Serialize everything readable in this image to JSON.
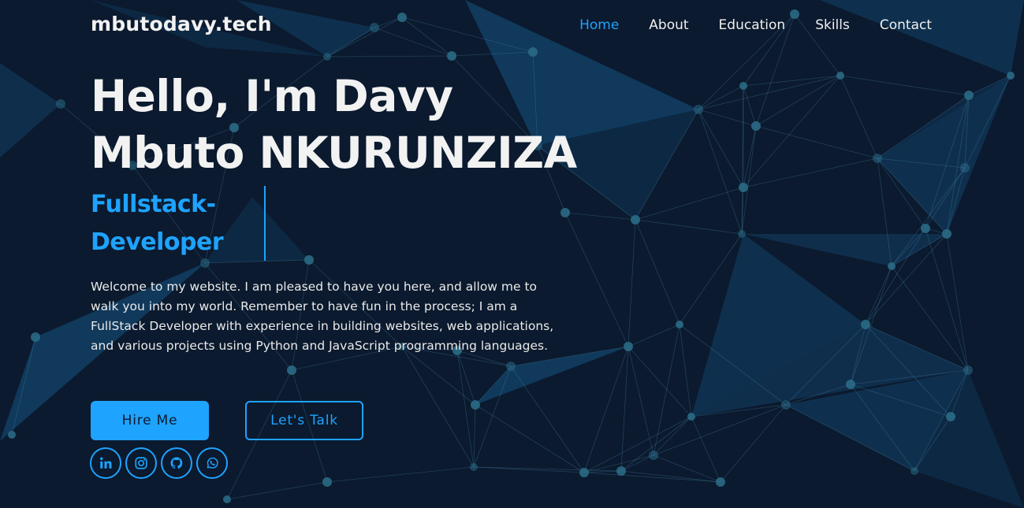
{
  "site": {
    "logo": "mbutodavy.tech"
  },
  "nav": {
    "items": [
      {
        "label": "Home",
        "active": true
      },
      {
        "label": "About"
      },
      {
        "label": "Education"
      },
      {
        "label": "Skills"
      },
      {
        "label": "Contact"
      }
    ]
  },
  "hero": {
    "heading_line1": "Hello, I'm Davy",
    "heading_line2": "Mbuto NKURUNZIZA",
    "role": "Fullstack-Developer",
    "intro": "Welcome to my website. I am pleased to have you here, and allow me to walk you into my world. Remember to have fun in the process; I am a FullStack Developer with experience in building websites, web applications, and various projects using Python and JavaScript programming languages."
  },
  "buttons": {
    "hire": "Hire Me",
    "talk": "Let's Talk"
  },
  "socials": [
    {
      "icon": "linkedin-icon"
    },
    {
      "icon": "instagram-icon"
    },
    {
      "icon": "github-icon"
    },
    {
      "icon": "whatsapp-icon"
    }
  ],
  "colors": {
    "accent": "#1ea3ff",
    "background": "#0b1a2e",
    "text": "#f2f2f2"
  }
}
